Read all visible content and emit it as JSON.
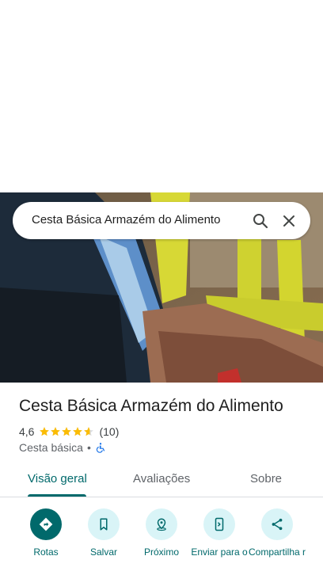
{
  "search": {
    "query": "Cesta Básica Armazém do Alimento"
  },
  "place": {
    "title": "Cesta Básica Armazém do Alimento",
    "rating": "4,6",
    "stars": 4.6,
    "review_count": "(10)",
    "category": "Cesta básica",
    "separator": "•"
  },
  "tabs": [
    {
      "label": "Visão geral",
      "active": true
    },
    {
      "label": "Avaliações",
      "active": false
    },
    {
      "label": "Sobre",
      "active": false
    }
  ],
  "actions": [
    {
      "label": "Rotas",
      "icon": "directions-icon"
    },
    {
      "label": "Salvar",
      "icon": "bookmark-icon"
    },
    {
      "label": "Próximo",
      "icon": "nearby-icon"
    },
    {
      "label": "Enviar para o",
      "icon": "send-to-phone-icon"
    },
    {
      "label": "Compartilha r",
      "icon": "share-icon"
    }
  ],
  "colors": {
    "accent": "#00696b",
    "action_bg": "#d9f4f7",
    "star": "#fbbc04"
  }
}
